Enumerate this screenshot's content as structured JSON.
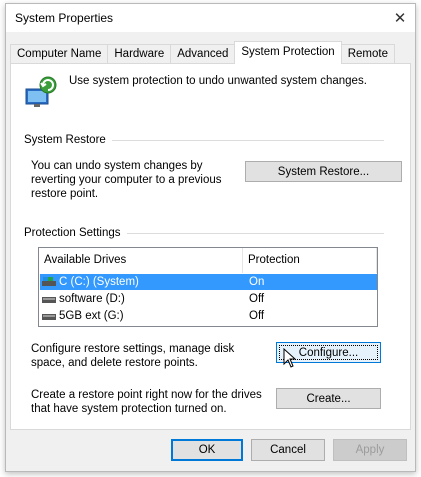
{
  "window": {
    "title": "System Properties"
  },
  "tabs": [
    {
      "label": "Computer Name",
      "active": false
    },
    {
      "label": "Hardware",
      "active": false
    },
    {
      "label": "Advanced",
      "active": false
    },
    {
      "label": "System Protection",
      "active": true
    },
    {
      "label": "Remote",
      "active": false
    }
  ],
  "intro": {
    "text": "Use system protection to undo unwanted system changes."
  },
  "system_restore": {
    "heading": "System Restore",
    "description": "You can undo system changes by reverting your computer to a previous restore point.",
    "button_label": "System Restore..."
  },
  "protection_settings": {
    "heading": "Protection Settings",
    "columns": [
      "Available Drives",
      "Protection"
    ],
    "drives": [
      {
        "name": "C (C:) (System)",
        "protection": "On",
        "selected": true,
        "icon": "system-drive-icon"
      },
      {
        "name": "software (D:)",
        "protection": "Off",
        "selected": false,
        "icon": "drive-icon"
      },
      {
        "name": "5GB ext (G:)",
        "protection": "Off",
        "selected": false,
        "icon": "drive-icon"
      }
    ],
    "configure_text": "Configure restore settings, manage disk space, and delete restore points.",
    "configure_label": "Configure...",
    "create_text": "Create a restore point right now for the drives that have system protection turned on.",
    "create_label": "Create..."
  },
  "footer": {
    "ok_label": "OK",
    "cancel_label": "Cancel",
    "apply_label": "Apply"
  },
  "colors": {
    "selection": "#3399ff",
    "focus": "#0078d7",
    "window_bg": "#f0f0f0"
  }
}
